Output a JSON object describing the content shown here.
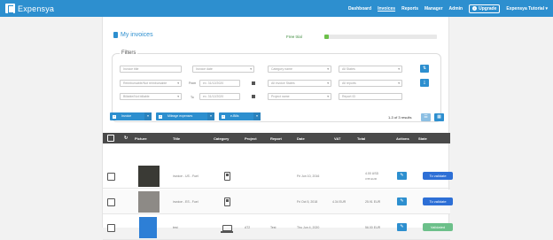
{
  "app": {
    "brand": "Expensya"
  },
  "nav": {
    "items": [
      "Dashboard",
      "Invoices",
      "Reports",
      "Manager",
      "Admin"
    ],
    "upgrade": "Upgrade",
    "user": "Expensya Tutorial"
  },
  "page": {
    "title": "My invoices",
    "free_trial": "Free trial",
    "trial_progress": 0.04
  },
  "filters": {
    "label": "Filters",
    "invoice_title": "Invoice title",
    "invoice_date": "Invoice date",
    "category": "Category name",
    "all_states": "All States",
    "reimbursable": "Reimbursable/Not reimbursable",
    "from_label": "From",
    "from_date": "ex. 31/12/2020",
    "all_invoice_states": "All invoice States",
    "all_reports": "All reports",
    "billable": "Billable/Not billable",
    "to_label": "To",
    "to_date": "ex. 31/12/2020",
    "project": "Project name",
    "report_id": "Report ID"
  },
  "actions": {
    "invoice": "Invoice",
    "mileage": "Mileage expenses",
    "ebills": "e-Bills",
    "results": "1-3 of 3 results"
  },
  "table": {
    "headers": [
      "Picture",
      "Title",
      "Category",
      "Project",
      "Report",
      "Date",
      "VAT",
      "Total",
      "Actions",
      "State"
    ],
    "rows": [
      {
        "title": "invoice - US - Fuel",
        "project": "",
        "report": "",
        "date": "Fri Jun 10, 2016",
        "vat": "",
        "total": "4.00 USD",
        "total_sub": "3.55 EUR",
        "state": "To validate",
        "state_color": "#2d6fd6",
        "category_icon": "fuel-icon"
      },
      {
        "title": "invoice - ES - Fuel",
        "project": "",
        "report": "",
        "date": "Fri Oct 5, 2018",
        "vat": "4.34 EUR",
        "total": "25.91 EUR",
        "total_sub": "",
        "state": "To validate",
        "state_color": "#2d6fd6",
        "category_icon": "fuel-icon"
      },
      {
        "title": "test",
        "project": "AT2",
        "report": "Test",
        "date": "Thu Jun 4, 2020",
        "vat": "",
        "total": "56.00 EUR",
        "total_sub": "",
        "state": "Validated",
        "state_color": "#6cc08a",
        "category_icon": "laptop-icon"
      }
    ]
  }
}
